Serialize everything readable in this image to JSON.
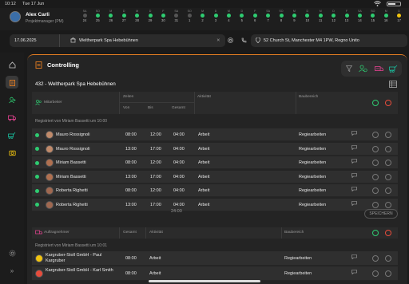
{
  "status": {
    "time": "10:12",
    "date": "Tue 17 Jun"
  },
  "user": {
    "name": "Alex Carli",
    "role": "Projektmanager (PM)"
  },
  "calendar": [
    {
      "dn": "SA",
      "dt": "24",
      "c": "grey"
    },
    {
      "dn": "SO",
      "dt": "25",
      "c": "green"
    },
    {
      "dn": "M",
      "dt": "26",
      "c": "green"
    },
    {
      "dn": "D",
      "dt": "27",
      "c": "green"
    },
    {
      "dn": "M",
      "dt": "28",
      "c": "green"
    },
    {
      "dn": "D",
      "dt": "29",
      "c": "green"
    },
    {
      "dn": "F",
      "dt": "30",
      "c": "green"
    },
    {
      "dn": "SA",
      "dt": "31",
      "c": "grey"
    },
    {
      "dn": "SO",
      "dt": "1",
      "c": "grey"
    },
    {
      "dn": "M",
      "dt": "2",
      "c": "green"
    },
    {
      "dn": "D",
      "dt": "3",
      "c": "green"
    },
    {
      "dn": "M",
      "dt": "4",
      "c": "green"
    },
    {
      "dn": "D",
      "dt": "5",
      "c": "green"
    },
    {
      "dn": "F",
      "dt": "6",
      "c": "green"
    },
    {
      "dn": "SA",
      "dt": "7",
      "c": "green"
    },
    {
      "dn": "SO",
      "dt": "8",
      "c": "green"
    },
    {
      "dn": "M",
      "dt": "9",
      "c": "green"
    },
    {
      "dn": "D",
      "dt": "10",
      "c": "green"
    },
    {
      "dn": "M",
      "dt": "11",
      "c": "green"
    },
    {
      "dn": "D",
      "dt": "12",
      "c": "green"
    },
    {
      "dn": "F",
      "dt": "13",
      "c": "green"
    },
    {
      "dn": "SA",
      "dt": "14",
      "c": "green"
    },
    {
      "dn": "SO",
      "dt": "15",
      "c": "green"
    },
    {
      "dn": "M",
      "dt": "16",
      "c": "green"
    },
    {
      "dn": "D",
      "dt": "17",
      "c": "yellow"
    }
  ],
  "location": {
    "date": "17.06.2025",
    "project": "Weltherpark Spa Hebebühnen",
    "address": "52 Church St, Manchester M4 1PW, Regno Unito"
  },
  "panel": {
    "title": "Controlling",
    "project_title": "432 - Weltherpark Spa Hebebühnen"
  },
  "table1": {
    "headers": {
      "employee": "Mitarbeiter",
      "times": "Zeiten",
      "from": "Von",
      "to": "Bis",
      "total": "Gesamt",
      "activity": "Aktivität",
      "area": "Baubereich"
    },
    "registered": "Registriert von Miriam Bassetti um 10:00",
    "rows": [
      {
        "name": "Mauro Rossignoli",
        "from": "08:00",
        "to": "12:00",
        "total": "04:00",
        "activity": "Arbeit",
        "area": "Regiearbeiten"
      },
      {
        "name": "Mauro Rossignoli",
        "from": "13:00",
        "to": "17:00",
        "total": "04:00",
        "activity": "Arbeit",
        "area": "Regiearbeiten"
      },
      {
        "name": "Miriam Bassetti",
        "from": "08:00",
        "to": "12:00",
        "total": "04:00",
        "activity": "Arbeit",
        "area": "Regiearbeiten"
      },
      {
        "name": "Miriam Bassetti",
        "from": "13:00",
        "to": "17:00",
        "total": "04:00",
        "activity": "Arbeit",
        "area": "Regiearbeiten"
      },
      {
        "name": "Roberta Righetti",
        "from": "08:00",
        "to": "12:00",
        "total": "04:00",
        "activity": "Arbeit",
        "area": "Regiearbeiten"
      },
      {
        "name": "Roberta Righetti",
        "from": "13:00",
        "to": "17:00",
        "total": "04:00",
        "activity": "Arbeit",
        "area": "Regiearbeiten"
      }
    ],
    "sum": "24:00",
    "save_label": "SPEICHERN"
  },
  "table2": {
    "headers": {
      "client": "Auftragnehmer",
      "total": "Gesamt",
      "activity": "Aktivität",
      "area": "Baubereich"
    },
    "registered": "Registriert von Miriam Bassetti um 10:01",
    "rows": [
      {
        "name": "Kargruber-Stoll GmbH - Paul Kargruber",
        "total": "08:00",
        "activity": "Arbeit",
        "area": "Regiearbeiten"
      },
      {
        "name": "Kargruber-Stoll GmbH - Karl Smith",
        "total": "08:00",
        "activity": "Arbeit",
        "area": "Regiearbeiten"
      }
    ]
  },
  "colors": {
    "accent": "#e67e22",
    "green": "#2ecc71",
    "pink": "#e84393",
    "teal": "#1abc9c"
  }
}
